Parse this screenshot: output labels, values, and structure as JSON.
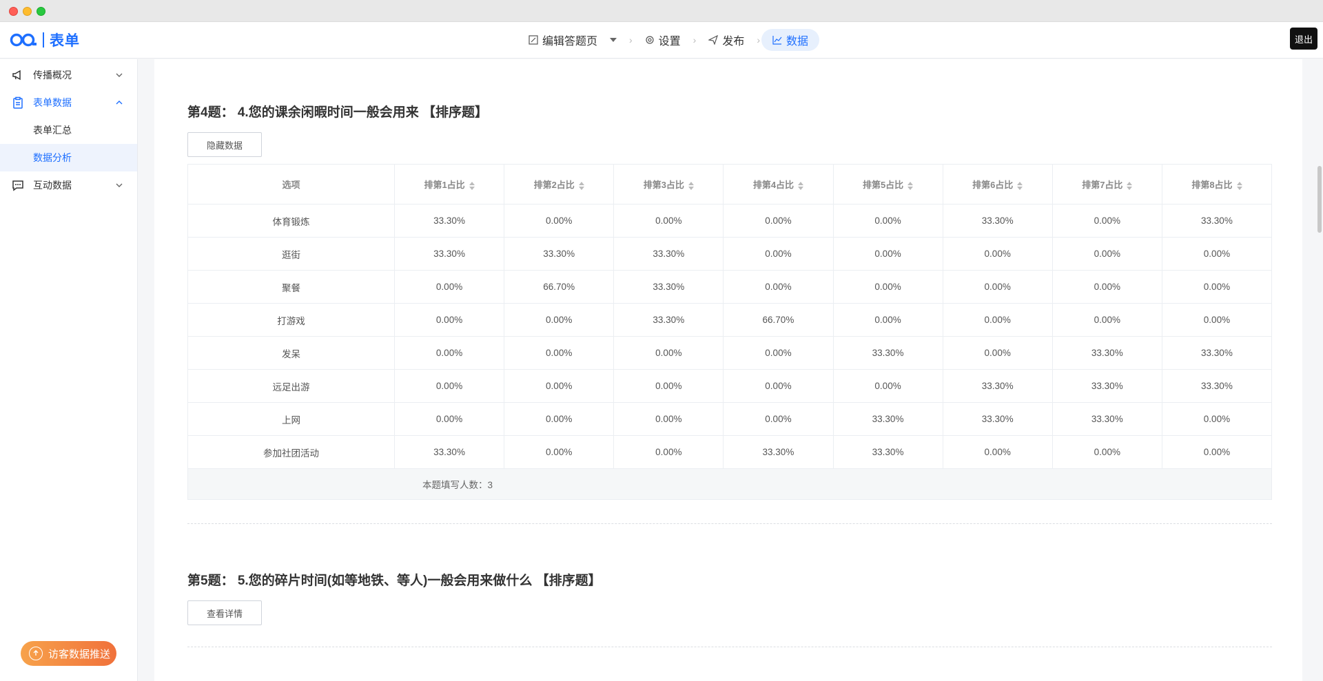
{
  "app": {
    "logo_text": "表单",
    "logout_label": "退出"
  },
  "steps": [
    {
      "label": "编辑答题页",
      "icon": "edit-icon"
    },
    {
      "label": "设置",
      "icon": "gear-icon"
    },
    {
      "label": "发布",
      "icon": "send-icon"
    },
    {
      "label": "数据",
      "icon": "chart-line-icon"
    }
  ],
  "sidebar": {
    "items": [
      {
        "label": "传播概况"
      },
      {
        "label": "表单数据",
        "sub": [
          "表单汇总",
          "数据分析"
        ]
      },
      {
        "label": "互动数据"
      }
    ],
    "push_label": "访客数据推送"
  },
  "q4": {
    "title": "第4题：  4.您的课余闲暇时间一般会用来 【排序题】",
    "button": "隐藏数据",
    "headers": [
      "选项",
      "排第1占比",
      "排第2占比",
      "排第3占比",
      "排第4占比",
      "排第5占比",
      "排第6占比",
      "排第7占比",
      "排第8占比"
    ],
    "rows": [
      [
        "体育锻炼",
        "33.30%",
        "0.00%",
        "0.00%",
        "0.00%",
        "0.00%",
        "33.30%",
        "0.00%",
        "33.30%"
      ],
      [
        "逛街",
        "33.30%",
        "33.30%",
        "33.30%",
        "0.00%",
        "0.00%",
        "0.00%",
        "0.00%",
        "0.00%"
      ],
      [
        "聚餐",
        "0.00%",
        "66.70%",
        "33.30%",
        "0.00%",
        "0.00%",
        "0.00%",
        "0.00%",
        "0.00%"
      ],
      [
        "打游戏",
        "0.00%",
        "0.00%",
        "33.30%",
        "66.70%",
        "0.00%",
        "0.00%",
        "0.00%",
        "0.00%"
      ],
      [
        "发呆",
        "0.00%",
        "0.00%",
        "0.00%",
        "0.00%",
        "33.30%",
        "0.00%",
        "33.30%",
        "33.30%"
      ],
      [
        "远足出游",
        "0.00%",
        "0.00%",
        "0.00%",
        "0.00%",
        "0.00%",
        "33.30%",
        "33.30%",
        "33.30%"
      ],
      [
        "上网",
        "0.00%",
        "0.00%",
        "0.00%",
        "0.00%",
        "33.30%",
        "33.30%",
        "33.30%",
        "0.00%"
      ],
      [
        "参加社团活动",
        "33.30%",
        "0.00%",
        "0.00%",
        "33.30%",
        "33.30%",
        "0.00%",
        "0.00%",
        "0.00%"
      ]
    ],
    "footer": "本题填写人数：3"
  },
  "q5": {
    "title": "第5题：  5.您的碎片时间(如等地铁、等人)一般会用来做什么 【排序题】",
    "button": "查看详情"
  },
  "colors": {
    "accent": "#1e6fff",
    "push_start": "#f7a24b",
    "push_end": "#f0713b"
  }
}
